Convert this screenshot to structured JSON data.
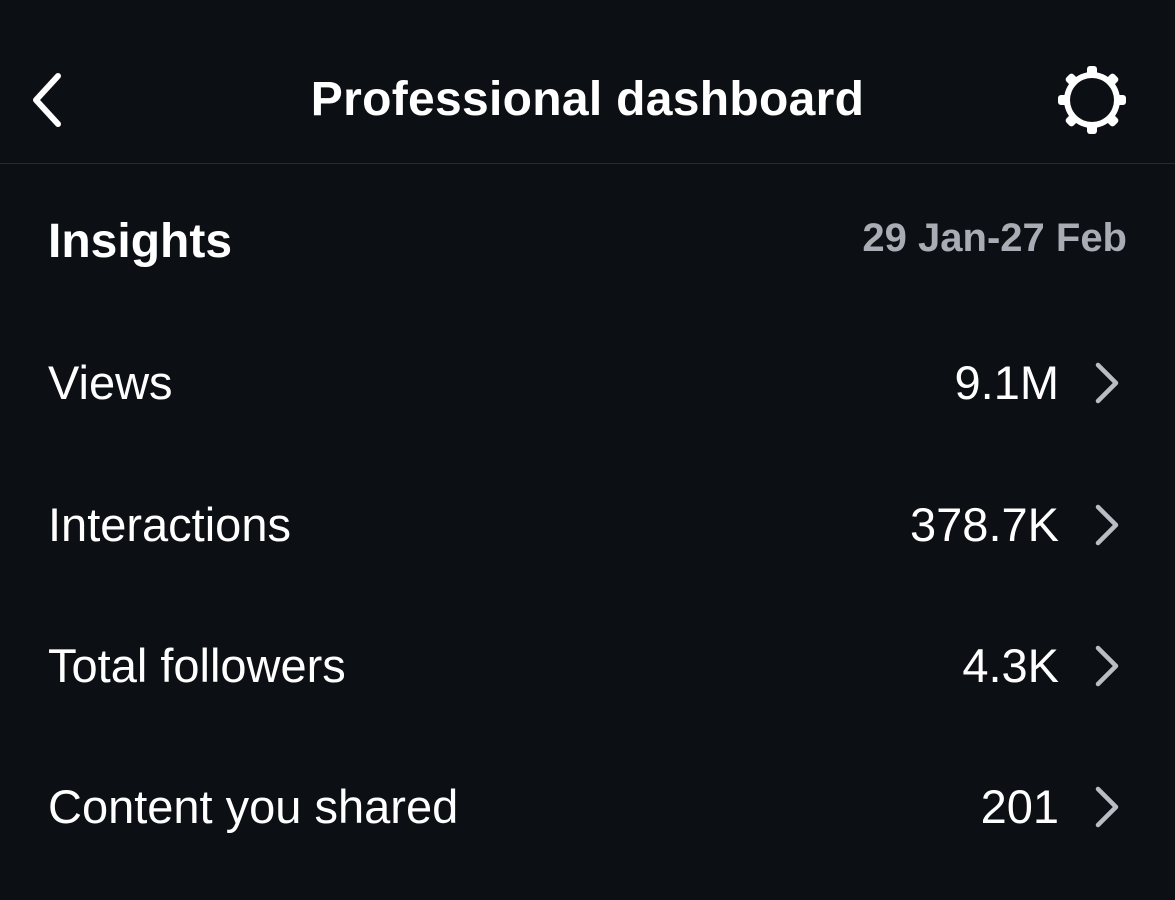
{
  "header": {
    "title": "Professional dashboard",
    "back_icon": "chevron-left-icon",
    "settings_icon": "gear-icon"
  },
  "insights": {
    "title": "Insights",
    "date_range": "29 Jan-27 Feb"
  },
  "metrics": [
    {
      "label": "Views",
      "value": "9.1M"
    },
    {
      "label": "Interactions",
      "value": "378.7K"
    },
    {
      "label": "Total followers",
      "value": "4.3K"
    },
    {
      "label": "Content you shared",
      "value": "201"
    }
  ],
  "colors": {
    "background": "#0c0f14",
    "text": "#ffffff",
    "muted_text": "#a8adb5",
    "chevron": "#b9bdc4",
    "divider": "#262a31"
  }
}
